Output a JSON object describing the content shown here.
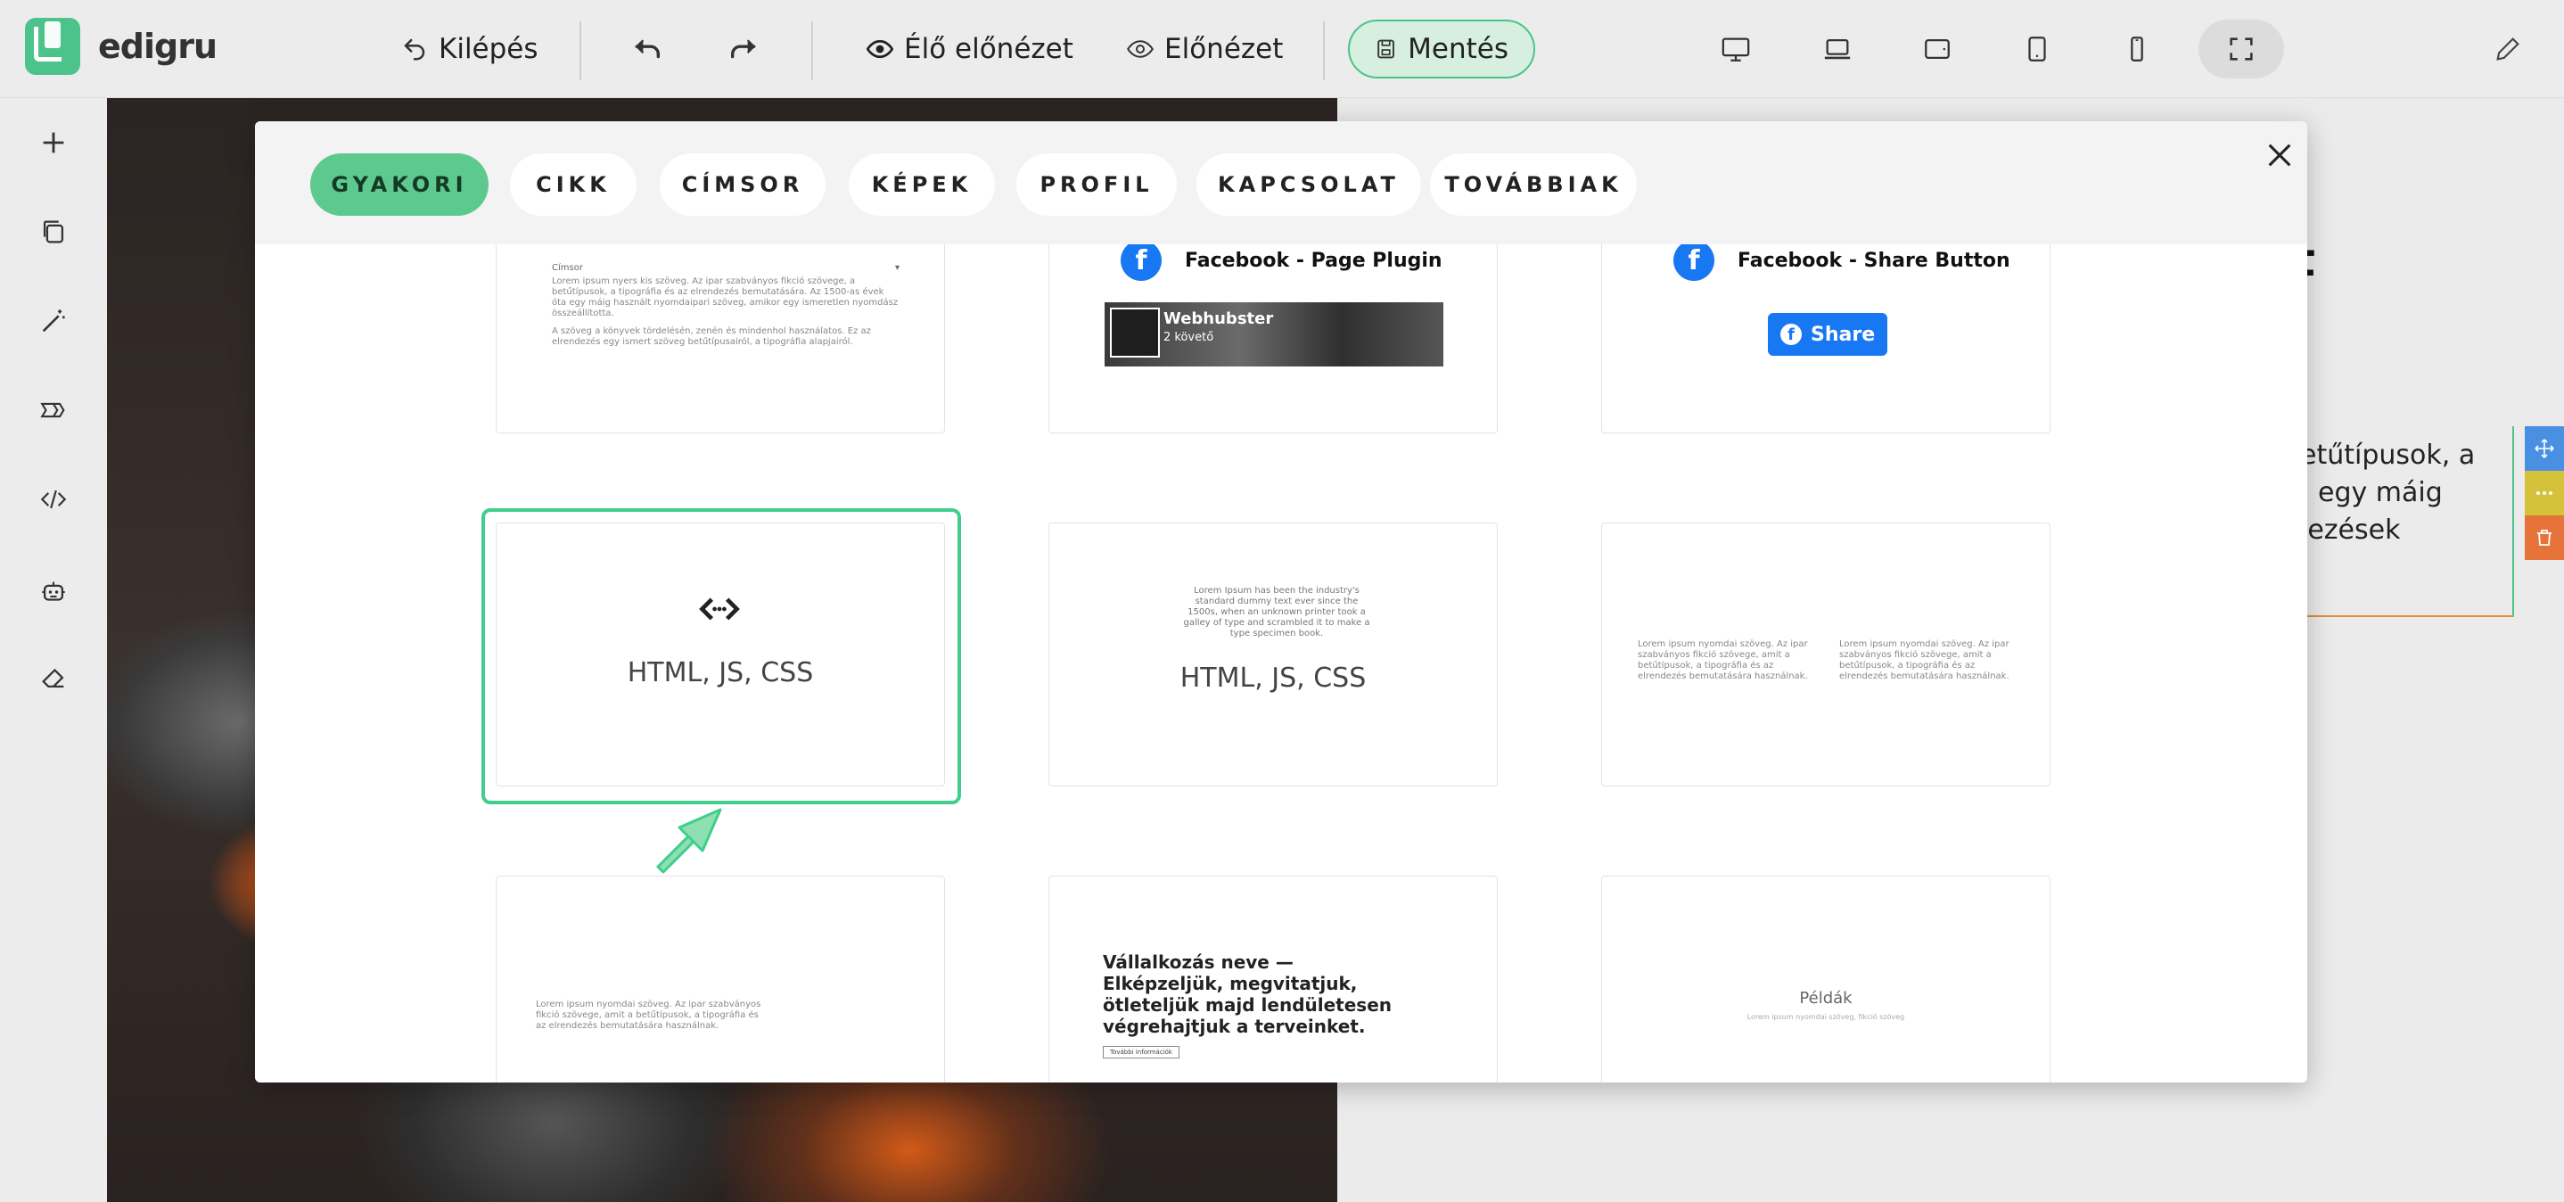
{
  "app": {
    "name": "edigru"
  },
  "toolbar": {
    "exit_label": "Kilépés",
    "live_preview_label": "Élő előnézet",
    "preview_label": "Előnézet",
    "save_label": "Mentés"
  },
  "canvas": {
    "heading_fragment": "t",
    "text_lines": [
      "etűtípusok, a",
      "egy máig",
      "lezések"
    ]
  },
  "modal": {
    "tabs": [
      {
        "label": "GYAKORI",
        "active": true
      },
      {
        "label": "CIKK",
        "active": false
      },
      {
        "label": "CÍMSOR",
        "active": false
      },
      {
        "label": "KÉPEK",
        "active": false
      },
      {
        "label": "PROFIL",
        "active": false
      },
      {
        "label": "KAPCSOLAT",
        "active": false
      },
      {
        "label": "TOVÁBBIAK",
        "active": false
      }
    ],
    "cards": {
      "article_small": {
        "title": "Címsor",
        "text1": "Lorem ipsum nyers kis szöveg. Az ipar szabványos fikció szövege, a betűtípusok, a tipográfia és az elrendezés bemutatására. Az 1500-as évek óta egy máig használt nyomdaipari szöveg, amikor egy ismeretlen nyomdász összeállította.",
        "text2": "A szöveg a könyvek tördelésén, zenén és mindenhol használatos. Ez az elrendezés egy ismert szöveg betűtípusairól, a tipográfia alapjairól."
      },
      "fb_page": {
        "title": "Facebook - Page Plugin",
        "page_name": "Webhubster",
        "followers": "2 követő"
      },
      "fb_share": {
        "title": "Facebook - Share Button",
        "button": "Share"
      },
      "html_selected": {
        "label": "HTML, JS, CSS"
      },
      "html_text": {
        "label": "HTML, JS, CSS",
        "text": "Lorem Ipsum has been the industry's standard dummy text ever since the 1500s, when an unknown printer took a galley of type and scrambled it to make a type specimen book."
      },
      "two_col": {
        "col1": "Lorem ipsum nyomdai szöveg. Az ipar szabványos fikció szövege, amit a betűtípusok, a tipográfia és az elrendezés bemutatására használnak.",
        "col2": "Lorem ipsum nyomdai szöveg. Az ipar szabványos fikció szövege, amit a betűtípusok, a tipográfia és az elrendezés bemutatására használnak."
      },
      "text_block": {
        "text": "Lorem ipsum nyomdai szöveg. Az ipar szabványos fikció szövege, amit a betűtípusok, a tipográfia és az elrendezés bemutatására használnak."
      },
      "business": {
        "headline": "Vállalkozás neve — Elképzeljük, megvitatjuk, ötleteljük majd lendületesen végrehajtjuk a terveinket.",
        "button": "További információk"
      },
      "examples": {
        "title": "Példák",
        "text": "Lorem ipsum nyomdai szöveg, fikció szöveg"
      }
    }
  },
  "colors": {
    "accent": "#4bc38a",
    "tab_active": "#5ec98e",
    "facebook": "#1877f2",
    "tool_move": "#4a90e2",
    "tool_more": "#d4c23a",
    "tool_delete": "#e5733a"
  },
  "icons": {
    "toolbar": [
      "undo-icon",
      "redo-icon",
      "eye-icon",
      "eye-outline-icon",
      "save-icon",
      "desktop-icon",
      "laptop-icon",
      "tablet-landscape-icon",
      "tablet-icon",
      "mobile-icon",
      "fullscreen-icon",
      "pencil-icon"
    ],
    "rail": [
      "plus-icon",
      "copy-icon",
      "magic-wand-icon",
      "sections-icon",
      "code-icon",
      "robot-icon",
      "eraser-icon"
    ]
  }
}
